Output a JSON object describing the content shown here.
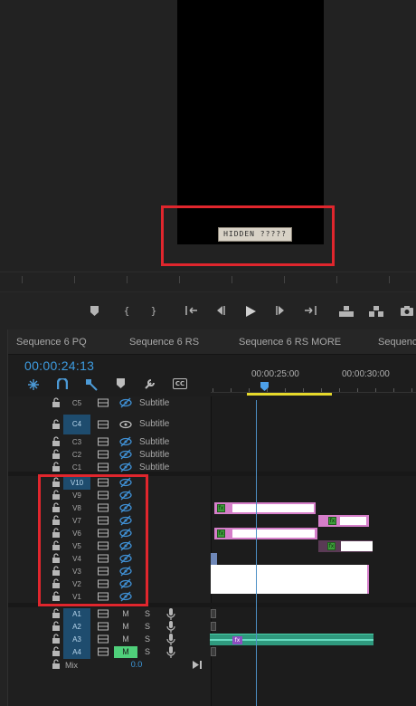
{
  "monitor": {
    "caption_text": "HIDDEN ?????"
  },
  "transport": {
    "buttons": [
      {
        "name": "add-marker-button",
        "glyph": "⬟"
      },
      {
        "name": "mark-in-button",
        "glyph": "{"
      },
      {
        "name": "mark-out-button",
        "glyph": "}"
      },
      {
        "name": "go-to-in-button",
        "glyph": "{←"
      },
      {
        "name": "step-back-button",
        "glyph": "◂|"
      },
      {
        "name": "play-button",
        "glyph": "▶"
      },
      {
        "name": "step-forward-button",
        "glyph": "|▸"
      },
      {
        "name": "go-to-out-button",
        "glyph": "→}"
      },
      {
        "name": "lift-button",
        "glyph": "⊡"
      },
      {
        "name": "extract-button",
        "glyph": "⊟"
      },
      {
        "name": "export-frame-button",
        "glyph": "◙"
      }
    ]
  },
  "timeline": {
    "tabs": [
      "Sequence 6 PQ",
      "Sequence 6 RS",
      "Sequence 6 RS MORE",
      "Sequence"
    ],
    "timecode": "00:00:24:13",
    "tools": {
      "snap_icon": "snap-icon",
      "linked_icon": "linked-selection-icon",
      "markers_icon": "add-marker-icon",
      "wrench_icon": "wrench-icon",
      "cc_label": "CC"
    },
    "ruler": {
      "label_1": "00:00:25:00",
      "label_2": "00:00:30:00"
    },
    "caption_tracks": [
      {
        "label": "C5",
        "text": "Subtitle",
        "eye_open": false
      },
      {
        "label": "C4",
        "text": "Subtitle",
        "eye_open": true,
        "active": true
      },
      {
        "label": "C3",
        "text": "Subtitle",
        "eye_open": false
      },
      {
        "label": "C2",
        "text": "Subtitle",
        "eye_open": false
      },
      {
        "label": "C1",
        "text": "Subtitle",
        "eye_open": false
      }
    ],
    "video_tracks": [
      {
        "label": "V10",
        "active": true
      },
      {
        "label": "V9"
      },
      {
        "label": "V8"
      },
      {
        "label": "V7"
      },
      {
        "label": "V6"
      },
      {
        "label": "V5"
      },
      {
        "label": "V4"
      },
      {
        "label": "V3"
      },
      {
        "label": "V2"
      },
      {
        "label": "V1"
      }
    ],
    "audio_tracks": [
      {
        "label": "A1",
        "m": "M",
        "s": "S"
      },
      {
        "label": "A2",
        "m": "M",
        "s": "S"
      },
      {
        "label": "A3",
        "m": "M",
        "s": "S"
      },
      {
        "label": "A4",
        "m": "M",
        "s": "S",
        "muted": true
      }
    ],
    "mix": {
      "label": "Mix",
      "value": "0.0"
    },
    "fx_label": "fx"
  },
  "colors": {
    "accent": "#3d9be0",
    "highlight": "#e0262d",
    "clip_pink": "#d57ec9",
    "audio_clip": "#2f9a7e",
    "mute_on": "#4fcf7a",
    "work_area": "#e6d92b"
  }
}
